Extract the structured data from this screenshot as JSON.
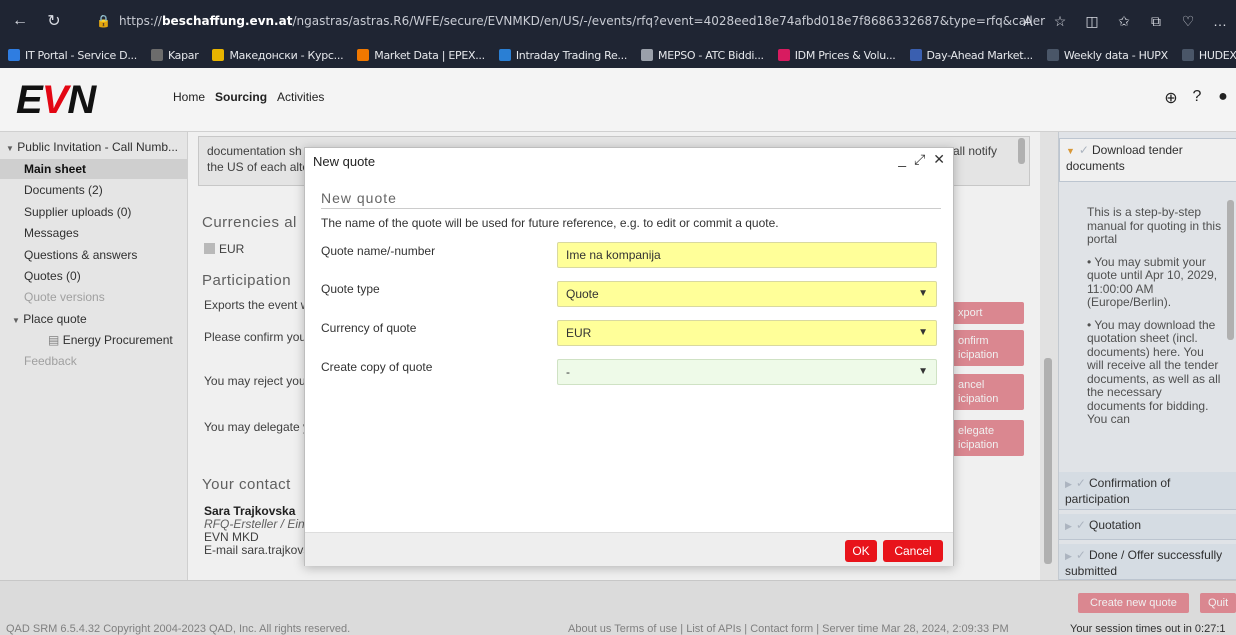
{
  "browser": {
    "url_prefix": "https://",
    "url_host": "beschaffung.evn.at",
    "url_path": "/ngastras/astras.R6/WFE/secure/EVNMKD/en/US/-/events/rfq?event=4028eed18e74afbd018e7f8686332687&type=rfq&caller=%2Fevents%2Flist&",
    "bookmarks": [
      {
        "label": "IT Portal - Service D...",
        "color": "#2f7de1"
      },
      {
        "label": "Kapar",
        "color": "#6c6c6c"
      },
      {
        "label": "Македонски - Курс...",
        "color": "#e8b400"
      },
      {
        "label": "Market Data | EPEX...",
        "color": "#f07800"
      },
      {
        "label": "Intraday Trading Re...",
        "color": "#2a7fd4"
      },
      {
        "label": "MEPSO - ATC Biddi...",
        "color": "#9aa0aa"
      },
      {
        "label": "IDM Prices & Volu...",
        "color": "#d81b60"
      },
      {
        "label": "Day-Ahead Market...",
        "color": "#3a5fb0"
      },
      {
        "label": "Weekly data - HUPX",
        "color": "#4a5668"
      },
      {
        "label": "HUDEX",
        "color": "#4a5668"
      }
    ]
  },
  "app": {
    "logo_e": "E",
    "logo_v": "V",
    "logo_n": "N",
    "nav": [
      "Home",
      "Sourcing",
      "Activities"
    ]
  },
  "sidebar": {
    "root": "Public Invitation - Call Numb...",
    "items": [
      "Main sheet",
      "Documents (2)",
      "Supplier uploads (0)",
      "Messages",
      "Questions & answers",
      "Quotes (0)",
      "Quote versions",
      "Place quote",
      "Energy Procurement",
      "Feedback"
    ]
  },
  "content": {
    "doc_line1": "documentation sh",
    "doc_line2": "the US of each alte",
    "doc_tail": "all notify",
    "currencies_title": "Currencies al",
    "eur": "EUR",
    "participation_title": "Participation",
    "exports_text": "Exports the event w",
    "confirm_text": "Please confirm you",
    "reject_text": "You may reject you",
    "delegate_text": "You may delegate y",
    "btn_export": "xport",
    "btn_confirm_1": "onfirm",
    "btn_confirm_2": "icipation",
    "btn_cancel_1": "ancel",
    "btn_cancel_2": "icipation",
    "btn_delegate_1": "elegate",
    "btn_delegate_2": "icipation",
    "contact_title": "Your contact",
    "contact_name": "Sara Trajkovska",
    "contact_role": "RFQ-Ersteller / Eink",
    "contact_org": "EVN MKD",
    "contact_email": "E-mail sara.trajkovs"
  },
  "rpanel": {
    "download": "Download tender documents",
    "body_1": "This is a step-by-step manual for quoting in this portal",
    "body_2": "• You may submit your quote until Apr 10, 2029, 11:00:00 AM (Europe/Berlin).",
    "body_3": "• You may download the quotation sheet (incl. documents) here. You will receive all the tender documents, as well as all the necessary documents for bidding. You can",
    "confirmation": "Confirmation of participation",
    "quotation": "Quotation",
    "done": "Done / Offer successfully submitted"
  },
  "footer": {
    "create_btn": "Create new quote",
    "quit_btn": "Quit",
    "copyright": "QAD SRM 6.5.4.32 Copyright 2004-2023 QAD, Inc. All rights reserved.",
    "links": "About us Terms of use  |  List of APIs  |  Contact form  |  Server time  Mar 28, 2024, 2:09:33 PM",
    "session": "Your session times out in 0:27:1"
  },
  "modal": {
    "title": "New quote",
    "subtitle": "New quote",
    "description": "The name of the quote will be used for future reference, e.g. to edit or commit a quote.",
    "name_label": "Quote name/-number",
    "name_value": "Ime na kompanija",
    "type_label": "Quote type",
    "type_value": "Quote",
    "currency_label": "Currency of quote",
    "currency_value": "EUR",
    "copy_label": "Create copy of quote",
    "copy_value": "-",
    "ok": "OK",
    "cancel": "Cancel"
  }
}
